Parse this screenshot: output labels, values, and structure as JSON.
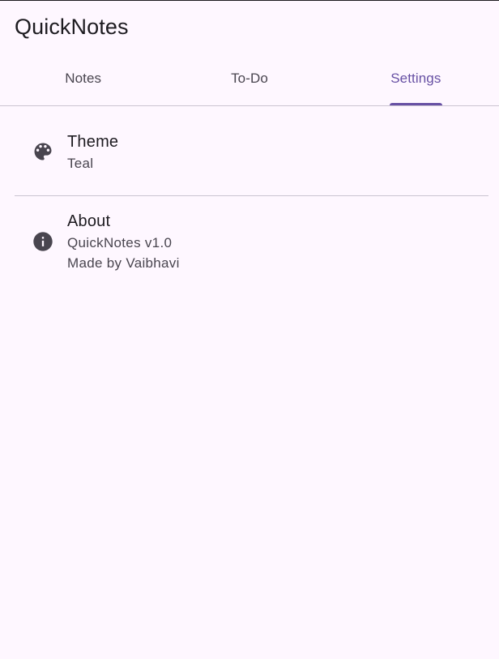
{
  "app": {
    "title": "QuickNotes"
  },
  "tabs": [
    {
      "label": "Notes",
      "active": false
    },
    {
      "label": "To-Do",
      "active": false
    },
    {
      "label": "Settings",
      "active": true
    }
  ],
  "settings": {
    "theme": {
      "icon": "palette-icon",
      "title": "Theme",
      "value": "Teal"
    },
    "about": {
      "icon": "info-icon",
      "title": "About",
      "version": "QuickNotes v1.0",
      "author": "Made by Vaibhavi"
    }
  },
  "colors": {
    "background": "#fef7ff",
    "accent": "#6750a4",
    "divider": "#cac4d0",
    "icon": "#49454f"
  }
}
